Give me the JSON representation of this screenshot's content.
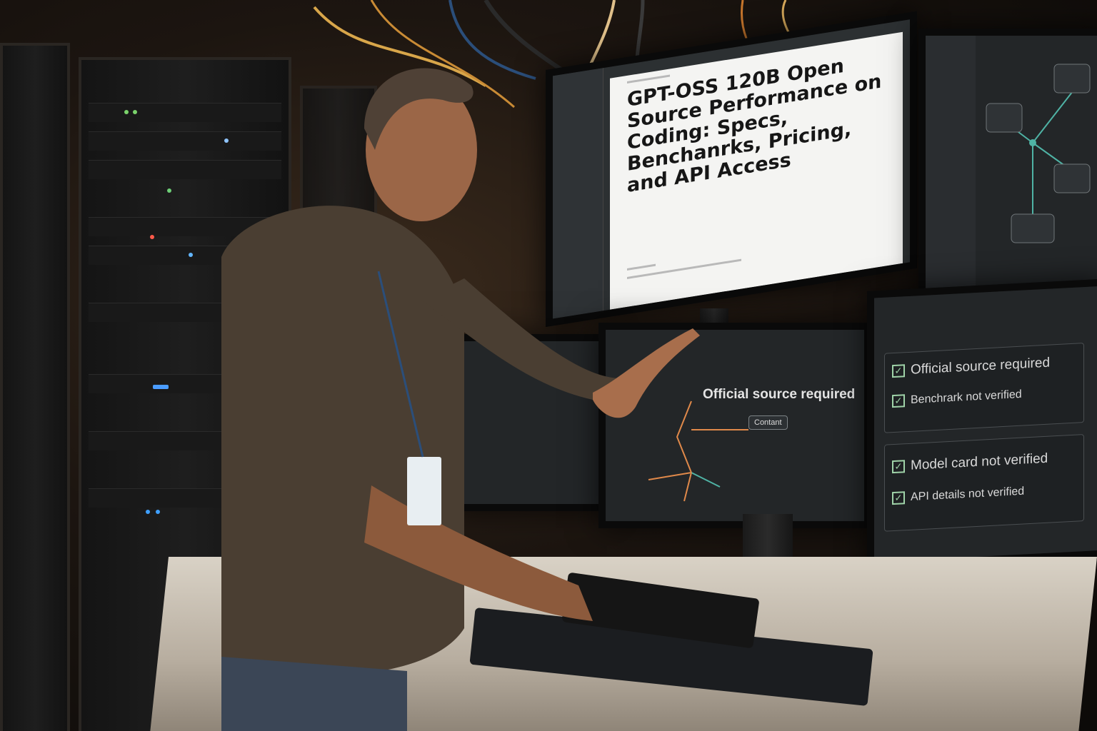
{
  "main_monitor": {
    "title": "GPT-OSS 120B Open Source Performance on Coding: Specs, Benchanrks, Pricing, and API Access"
  },
  "center_monitor": {
    "heading": "Official source required",
    "nodes": [
      "Contant"
    ]
  },
  "right_monitor": {
    "checks": [
      "Official source required",
      "Benchrark not verified",
      "Model card not verified",
      "API details not verified"
    ]
  },
  "colors": {
    "ambient": "#3a2a1c",
    "check_accent": "#9fd3a8",
    "graph_edge": "#e0894a",
    "node_accent": "#4fb3a5"
  }
}
